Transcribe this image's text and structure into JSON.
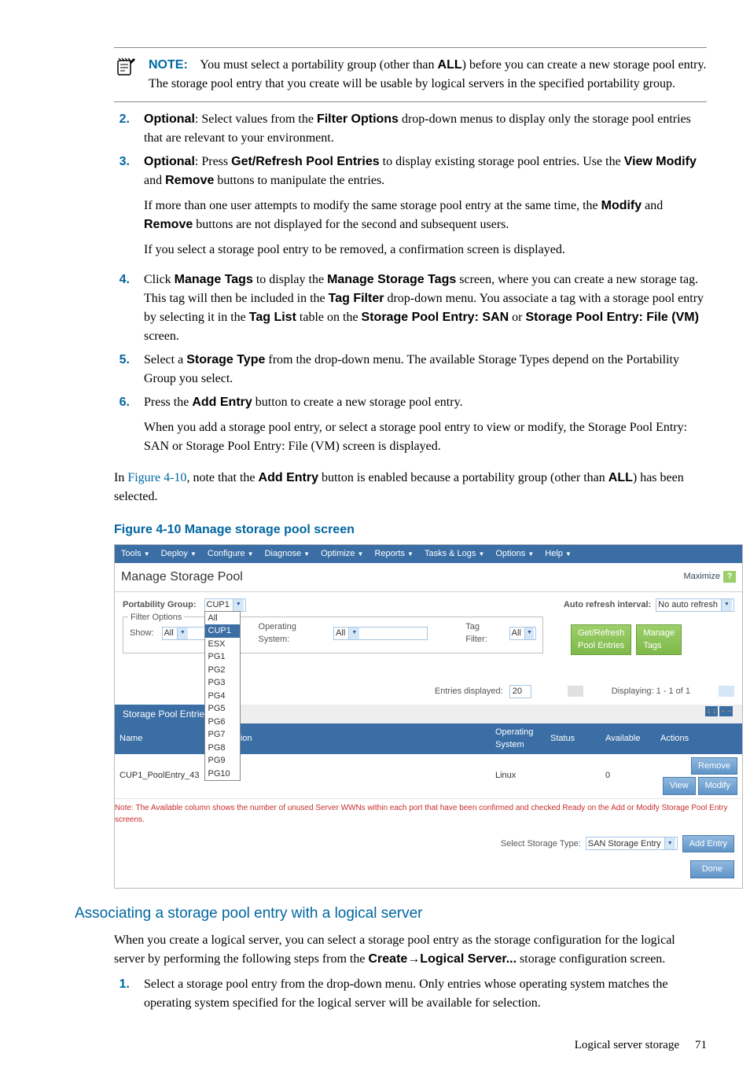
{
  "note": {
    "label": "NOTE:",
    "text_before": "You must select a portability group (other than ",
    "text_bold": "ALL",
    "text_after": ") before you can create a new storage pool entry. The storage pool entry that you create will be usable by logical servers in the specified portability group."
  },
  "steps": {
    "s2": {
      "num": "2.",
      "a": "Optional",
      "b": ": Select values from the ",
      "c": "Filter Options",
      "d": " drop-down menus to display only the storage pool entries that are relevant to your environment."
    },
    "s3": {
      "num": "3.",
      "a": "Optional",
      "b": ": Press ",
      "c": "Get/Refresh Pool Entries",
      "d": " to display existing storage pool entries. Use the ",
      "e": "View Modify",
      "f": " and ",
      "g": "Remove",
      "h": " buttons to manipulate the entries.",
      "p2a": "If more than one user attempts to modify the same storage pool entry at the same time, the ",
      "p2b": "Modify",
      "p2c": " and ",
      "p2d": "Remove",
      "p2e": " buttons are not displayed for the second and subsequent users.",
      "p3": "If you select a storage pool entry to be removed, a confirmation screen is displayed."
    },
    "s4": {
      "num": "4.",
      "a": "Click ",
      "b": "Manage Tags",
      "c": " to display the ",
      "d": "Manage Storage Tags",
      "e": " screen, where you can create a new storage tag. This tag will then be included in the ",
      "f": "Tag Filter",
      "g": " drop-down menu. You associate a tag with a storage pool entry by selecting it in the ",
      "h": "Tag List",
      "i": " table on the ",
      "j": "Storage Pool Entry: SAN",
      "k": " or ",
      "l": "Storage Pool Entry: File (VM)",
      "m": " screen."
    },
    "s5": {
      "num": "5.",
      "a": "Select a ",
      "b": "Storage Type",
      "c": " from the drop-down menu. The available Storage Types depend on the Portability Group you select."
    },
    "s6": {
      "num": "6.",
      "a": "Press the ",
      "b": "Add Entry",
      "c": " button to create a new storage pool entry.",
      "p2": "When you add a storage pool entry, or select a storage pool entry to view or modify, the Storage Pool Entry: SAN or Storage Pool Entry: File (VM) screen is displayed."
    }
  },
  "pre_figure": {
    "a": "In ",
    "link": "Figure 4-10",
    "b": ", note that the ",
    "c": "Add Entry",
    "d": " button is enabled because a portability group (other than ",
    "e": "ALL",
    "f": ") has been selected."
  },
  "figure_caption": "Figure 4-10 Manage storage pool screen",
  "app": {
    "menus": [
      "Tools",
      "Deploy",
      "Configure",
      "Diagnose",
      "Optimize",
      "Reports",
      "Tasks & Logs",
      "Options",
      "Help"
    ],
    "title": "Manage Storage Pool",
    "maximize": "Maximize",
    "help_q": "?",
    "portability_label": "Portability Group:",
    "portability_value": "CUP1",
    "portability_options": [
      "All",
      "CUP1",
      "ESX",
      "PG1",
      "PG2",
      "PG3",
      "PG4",
      "PG5",
      "PG6",
      "PG7",
      "PG8",
      "PG9",
      "PG10"
    ],
    "auto_refresh_label": "Auto refresh interval:",
    "auto_refresh_value": "No auto refresh",
    "filter_legend": "Filter Options",
    "show_label": "Show:",
    "show_value": "All",
    "os_label": "Operating System:",
    "os_value": "All",
    "tag_label": "Tag Filter:",
    "tag_value": "All",
    "get_refresh_btn": "Get/Refresh Pool Entries",
    "manage_tags_btn": "Manage Tags",
    "entries_label": "Entries displayed:",
    "entries_value": "20",
    "displaying": "Displaying: 1 - 1 of 1",
    "tab": "Storage Pool Entries",
    "columns": [
      "Name",
      "Description",
      "Operating System",
      "Status",
      "Available",
      "Actions"
    ],
    "row": {
      "name": "CUP1_PoolEntry_43",
      "desc": "",
      "os": "Linux",
      "status": "",
      "available": "0",
      "remove": "Remove",
      "view": "View",
      "modify": "Modify"
    },
    "note_line": "Note: The Available column shows the number of unused Server WWNs within each port that have been confirmed and checked Ready on the Add or Modify Storage Pool Entry screens.",
    "storage_type_label": "Select Storage Type:",
    "storage_type_value": "SAN Storage Entry",
    "add_entry_btn": "Add Entry",
    "done_btn": "Done"
  },
  "section_heading": "Associating a storage pool entry with a logical server",
  "section_para": {
    "a": "When you create a logical server, you can select a storage pool entry as the storage configuration for the logical server by performing the following steps from the ",
    "b": "Create",
    "arrow": "→",
    "c": "Logical Server...",
    "d": " storage configuration screen."
  },
  "section_step1": {
    "num": "1.",
    "text": "Select a storage pool entry from the drop-down menu. Only entries whose operating system matches the operating system specified for the logical server will be available for selection."
  },
  "footer": {
    "section": "Logical server storage",
    "page": "71"
  }
}
